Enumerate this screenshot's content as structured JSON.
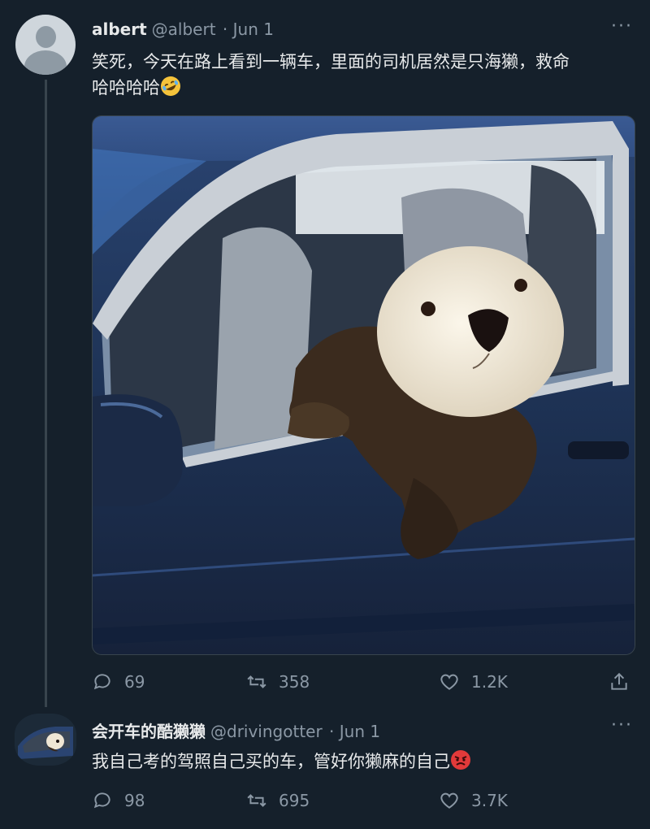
{
  "tweet": {
    "author_name": "albert",
    "author_handle": "@albert",
    "date": "· Jun 1",
    "more_label": "···",
    "text_line1": "笑死，今天在路上看到一辆车，里面的司机居然是只海獭，救命",
    "text_line2": "哈哈哈哈",
    "text_emoji": "rolling-on-floor-laughing-emoji",
    "media_description_icon": "sea-otter-in-car-photo",
    "replies": "69",
    "retweets": "358",
    "likes": "1.2K"
  },
  "reply": {
    "author_name": "会开车的酷獭獭",
    "author_handle": "@drivingotter",
    "date": "· Jun 1",
    "more_label": "···",
    "text": "我自己考的驾照自己买的车，管好你獭麻的自己",
    "text_emoji": "angry-face-emoji",
    "replies": "98",
    "retweets": "695",
    "likes": "3.7K"
  },
  "colors": {
    "background": "#15202b",
    "text": "#e7e9ea",
    "muted": "#8b98a5",
    "car_blue": "#1e3356"
  }
}
